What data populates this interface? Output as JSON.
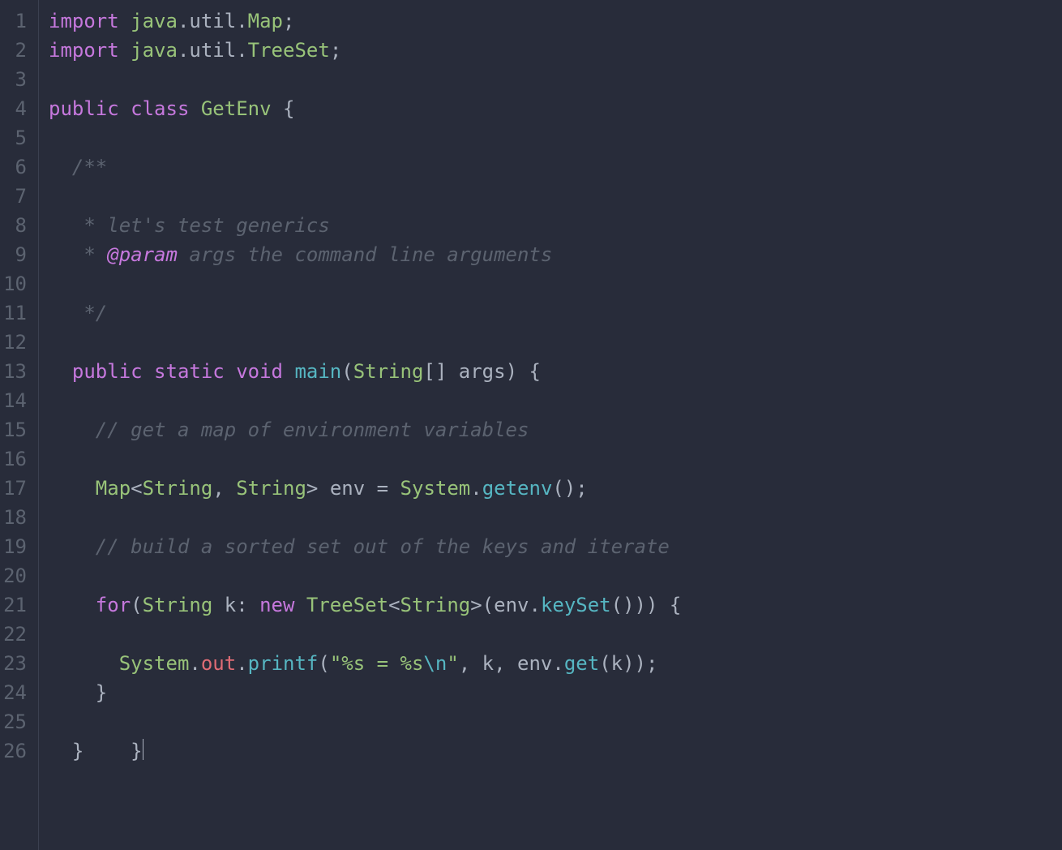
{
  "editor": {
    "language": "java",
    "theme_colors": {
      "background": "#282c3a",
      "foreground": "#abb2bf",
      "gutter": "#5c6370",
      "keyword": "#c678dd",
      "type": "#98c379",
      "function": "#56b6c2",
      "string": "#98c379",
      "comment": "#5c6370",
      "identifier_red": "#e06c75"
    },
    "line_numbers": [
      "1",
      "2",
      "3",
      "4",
      "5",
      "6",
      "7",
      "8",
      "9",
      "10",
      "11",
      "12",
      "13",
      "14",
      "15",
      "16",
      "17",
      "18",
      "19",
      "20",
      "21",
      "22",
      "23",
      "24",
      "25",
      "26"
    ],
    "lines": [
      [
        {
          "t": "import ",
          "c": "kw"
        },
        {
          "t": "java",
          "c": "cls"
        },
        {
          "t": ".",
          "c": "punc"
        },
        {
          "t": "util",
          "c": "ident"
        },
        {
          "t": ".",
          "c": "punc"
        },
        {
          "t": "Map",
          "c": "cls"
        },
        {
          "t": ";",
          "c": "punc"
        }
      ],
      [
        {
          "t": "import ",
          "c": "kw"
        },
        {
          "t": "java",
          "c": "cls"
        },
        {
          "t": ".",
          "c": "punc"
        },
        {
          "t": "util",
          "c": "ident"
        },
        {
          "t": ".",
          "c": "punc"
        },
        {
          "t": "TreeSet",
          "c": "cls"
        },
        {
          "t": ";",
          "c": "punc"
        }
      ],
      [],
      [
        {
          "t": "public class ",
          "c": "kw"
        },
        {
          "t": "GetEnv",
          "c": "cls"
        },
        {
          "t": " {",
          "c": "punc"
        }
      ],
      [],
      [
        {
          "t": "  /**",
          "c": "cmt"
        }
      ],
      [],
      [
        {
          "t": "   * let's test generics",
          "c": "cmt"
        }
      ],
      [
        {
          "t": "   * ",
          "c": "cmt"
        },
        {
          "t": "@param",
          "c": "doctag"
        },
        {
          "t": " args the command line arguments",
          "c": "cmt"
        }
      ],
      [],
      [
        {
          "t": "   */",
          "c": "cmt"
        }
      ],
      [],
      [
        {
          "t": "  ",
          "c": "punc"
        },
        {
          "t": "public static ",
          "c": "kw"
        },
        {
          "t": "void ",
          "c": "kw"
        },
        {
          "t": "main",
          "c": "func"
        },
        {
          "t": "(",
          "c": "punc"
        },
        {
          "t": "String",
          "c": "cls"
        },
        {
          "t": "[] ",
          "c": "punc"
        },
        {
          "t": "args",
          "c": "ident"
        },
        {
          "t": ") {",
          "c": "punc"
        }
      ],
      [],
      [
        {
          "t": "    // get a map of environment variables",
          "c": "cmt"
        }
      ],
      [],
      [
        {
          "t": "    ",
          "c": "punc"
        },
        {
          "t": "Map",
          "c": "cls"
        },
        {
          "t": "<",
          "c": "punc"
        },
        {
          "t": "String",
          "c": "cls"
        },
        {
          "t": ", ",
          "c": "punc"
        },
        {
          "t": "String",
          "c": "cls"
        },
        {
          "t": "> ",
          "c": "punc"
        },
        {
          "t": "env",
          "c": "ident"
        },
        {
          "t": " = ",
          "c": "punc"
        },
        {
          "t": "System",
          "c": "cls"
        },
        {
          "t": ".",
          "c": "punc"
        },
        {
          "t": "getenv",
          "c": "func"
        },
        {
          "t": "();",
          "c": "punc"
        }
      ],
      [],
      [
        {
          "t": "    // build a sorted set out of the keys and iterate",
          "c": "cmt"
        }
      ],
      [],
      [
        {
          "t": "    ",
          "c": "punc"
        },
        {
          "t": "for",
          "c": "kw"
        },
        {
          "t": "(",
          "c": "punc"
        },
        {
          "t": "String",
          "c": "cls"
        },
        {
          "t": " k: ",
          "c": "punc"
        },
        {
          "t": "new ",
          "c": "kw"
        },
        {
          "t": "TreeSet",
          "c": "cls"
        },
        {
          "t": "<",
          "c": "punc"
        },
        {
          "t": "String",
          "c": "cls"
        },
        {
          "t": ">(",
          "c": "punc"
        },
        {
          "t": "env",
          "c": "ident"
        },
        {
          "t": ".",
          "c": "punc"
        },
        {
          "t": "keySet",
          "c": "func"
        },
        {
          "t": "())) {",
          "c": "punc"
        }
      ],
      [],
      [
        {
          "t": "      ",
          "c": "punc"
        },
        {
          "t": "System",
          "c": "cls"
        },
        {
          "t": ".",
          "c": "punc"
        },
        {
          "t": "out",
          "c": "field"
        },
        {
          "t": ".",
          "c": "punc"
        },
        {
          "t": "printf",
          "c": "func"
        },
        {
          "t": "(",
          "c": "punc"
        },
        {
          "t": "\"%s = %s",
          "c": "str"
        },
        {
          "t": "\\n",
          "c": "esc"
        },
        {
          "t": "\"",
          "c": "str"
        },
        {
          "t": ", k, ",
          "c": "punc"
        },
        {
          "t": "env",
          "c": "ident"
        },
        {
          "t": ".",
          "c": "punc"
        },
        {
          "t": "get",
          "c": "func"
        },
        {
          "t": "(k));",
          "c": "punc"
        }
      ],
      [
        {
          "t": "    }",
          "c": "punc"
        }
      ],
      [],
      [
        {
          "t": "  }    }",
          "c": "punc"
        },
        {
          "t": "",
          "c": "cursor"
        }
      ]
    ]
  }
}
